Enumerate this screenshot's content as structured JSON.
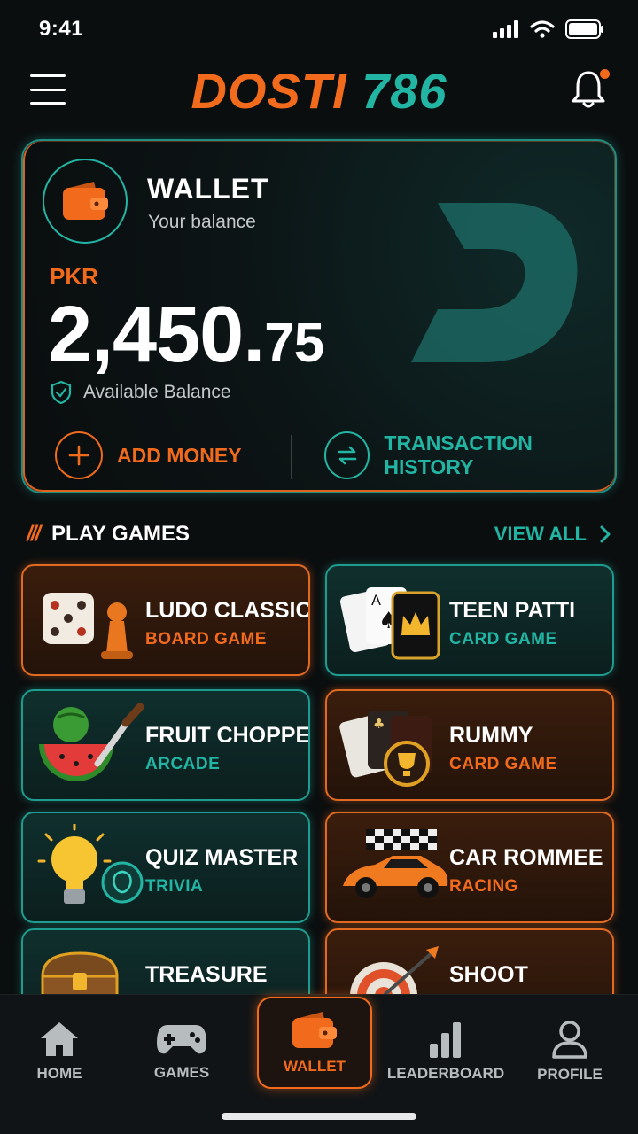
{
  "status_bar": {
    "time": "9:41"
  },
  "header": {
    "logo_part1": "DOSTI",
    "logo_part2": "786"
  },
  "wallet": {
    "title": "WALLET",
    "subtitle": "Your balance",
    "currency": "PKR",
    "amount_main": "2,450.",
    "amount_decimal": "75",
    "available_label": "Available Balance",
    "add_money_label": "ADD MONEY",
    "history_label": "TRANSACTION HISTORY"
  },
  "games_section": {
    "title": "PLAY GAMES",
    "view_all_label": "VIEW ALL",
    "games": [
      {
        "name": "LUDO CLASSIC",
        "category": "BOARD GAME",
        "theme": "orange",
        "icon": "dice-icon"
      },
      {
        "name": "TEEN PATTI",
        "category": "CARD GAME",
        "theme": "teal",
        "icon": "cards-crown-icon"
      },
      {
        "name": "FRUIT CHOPPER",
        "category": "ARCADE",
        "theme": "teal",
        "icon": "watermelon-knife-icon"
      },
      {
        "name": "RUMMY",
        "category": "CARD GAME",
        "theme": "orange",
        "icon": "cards-trophy-icon"
      },
      {
        "name": "QUIZ MASTER",
        "category": "TRIVIA",
        "theme": "teal",
        "icon": "lightbulb-icon"
      },
      {
        "name": "CAR ROMMEE",
        "category": "RACING",
        "theme": "orange",
        "icon": "race-car-icon"
      },
      {
        "name": "TREASURE",
        "category": "",
        "theme": "teal",
        "icon": "treasure-chest-icon"
      },
      {
        "name": "SHOOT",
        "category": "",
        "theme": "orange",
        "icon": "target-icon"
      }
    ]
  },
  "bottom_nav": {
    "items": [
      {
        "label": "HOME",
        "icon": "home-icon"
      },
      {
        "label": "GAMES",
        "icon": "gamepad-icon"
      },
      {
        "label": "WALLET",
        "icon": "wallet-icon",
        "active": true
      },
      {
        "label": "LEADERBOARD",
        "icon": "bar-chart-icon"
      },
      {
        "label": "PROFILE",
        "icon": "profile-icon"
      }
    ]
  },
  "colors": {
    "accent_orange": "#f26b1d",
    "accent_teal": "#22b5a3",
    "background": "#0b0e0f"
  }
}
